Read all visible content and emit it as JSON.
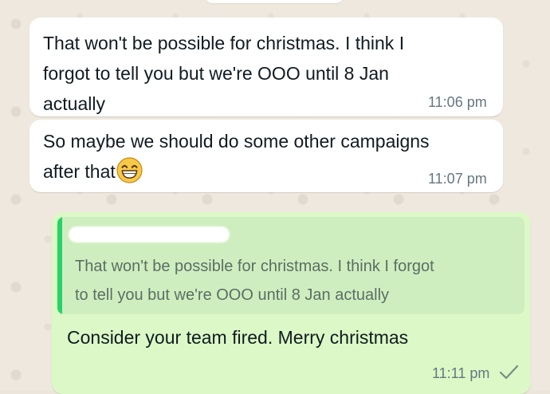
{
  "messages": [
    {
      "direction": "incoming",
      "text_lines": [
        "That won't be possible for christmas. I think I",
        "forgot to tell you but we're OOO until 8 Jan",
        "actually"
      ],
      "time": "11:06 pm"
    },
    {
      "direction": "incoming",
      "text_lines": [
        "So maybe we should do some other campaigns",
        "after that"
      ],
      "emoji": "grinning-face-with-smiling-eyes",
      "time": "11:07 pm"
    },
    {
      "direction": "outgoing",
      "reply": {
        "sender": "",
        "text_lines": [
          "That won't be possible for christmas. I think I forgot",
          "to tell you but we're OOO until 8 Jan actually"
        ]
      },
      "text": "Consider your team fired. Merry christmas",
      "time": "11:11 pm",
      "status": "sent-single-tick"
    }
  ],
  "colors": {
    "incoming_bubble": "#ffffff",
    "outgoing_bubble": "#dcf8c6",
    "reply_box": "#cfeec0",
    "reply_accent": "#25d366",
    "timestamp": "#667781",
    "text": "#111b21"
  }
}
